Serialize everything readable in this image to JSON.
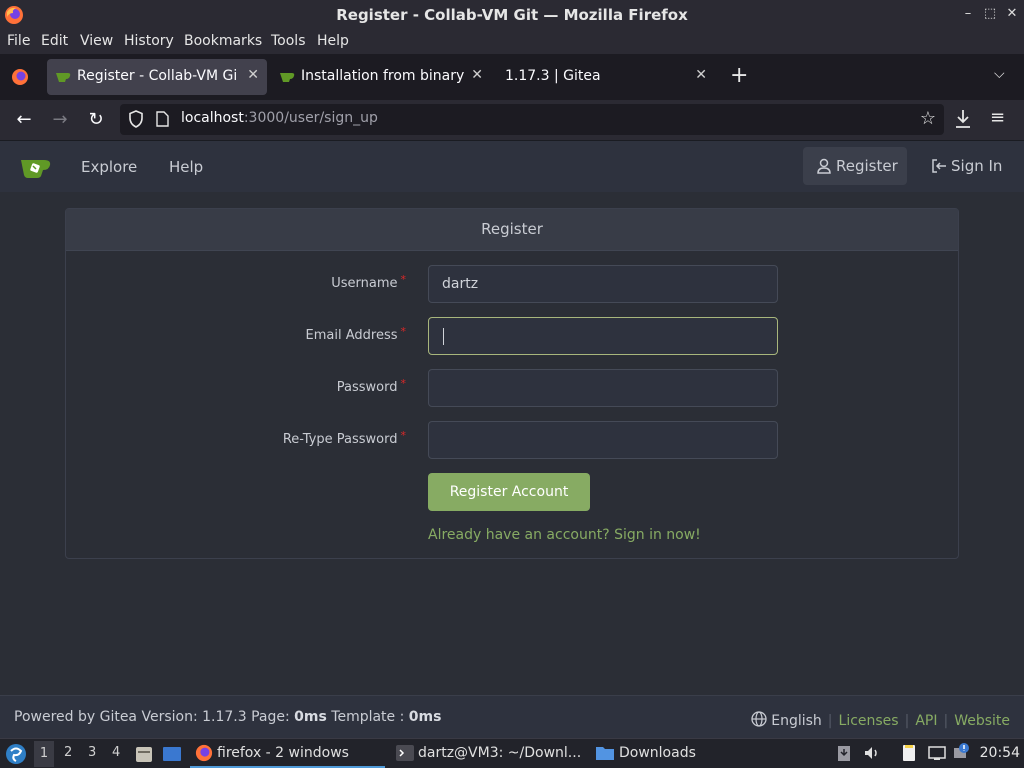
{
  "window": {
    "title": "Register - Collab-VM Git — Mozilla Firefox",
    "minimize": "–",
    "maximize": "⬚",
    "close": "✕"
  },
  "menubar": [
    "File",
    "Edit",
    "View",
    "History",
    "Bookmarks",
    "Tools",
    "Help"
  ],
  "tabs": [
    {
      "label": "Register - Collab-VM Git",
      "close": "✕"
    },
    {
      "label": "Installation from binary - ",
      "close": "✕"
    },
    {
      "label": "1.17.3 | Gitea",
      "close": "✕"
    }
  ],
  "tabstrip": {
    "new_tab": "+",
    "list_all": "⌵"
  },
  "navbar": {
    "back": "←",
    "forward": "→",
    "reload": "↻",
    "url_host": "localhost",
    "url_rest": ":3000/user/sign_up",
    "bookmark": "☆",
    "menu": "≡"
  },
  "gitea_nav": {
    "explore": "Explore",
    "help": "Help",
    "register": "Register",
    "signin": "Sign In"
  },
  "form": {
    "heading": "Register",
    "required_mark": "*",
    "username_label": "Username",
    "username_value": "dartz",
    "email_label": "Email Address",
    "email_value": "",
    "password_label": "Password",
    "retype_label": "Re-Type Password",
    "submit": "Register Account",
    "signin_link": "Already have an account? Sign in now!"
  },
  "footer": {
    "powered": "Powered by Gitea Version: 1.17.3 Page:",
    "page_time": "0ms",
    "template_label": "Template :",
    "template_time": "0ms",
    "language": "English",
    "licenses": "Licenses",
    "api": "API",
    "website": "Website",
    "separator": "|"
  },
  "taskbar": {
    "workspaces": [
      "1",
      "2",
      "3",
      "4"
    ],
    "tasks": [
      "firefox - 2 windows",
      "dartz@VM3: ~/Downl...",
      "Downloads"
    ],
    "clock": "20:54"
  },
  "colors": {
    "accent_green": "#87ab63",
    "required_red": "#db2828",
    "focus_border": "#a8b67c"
  }
}
